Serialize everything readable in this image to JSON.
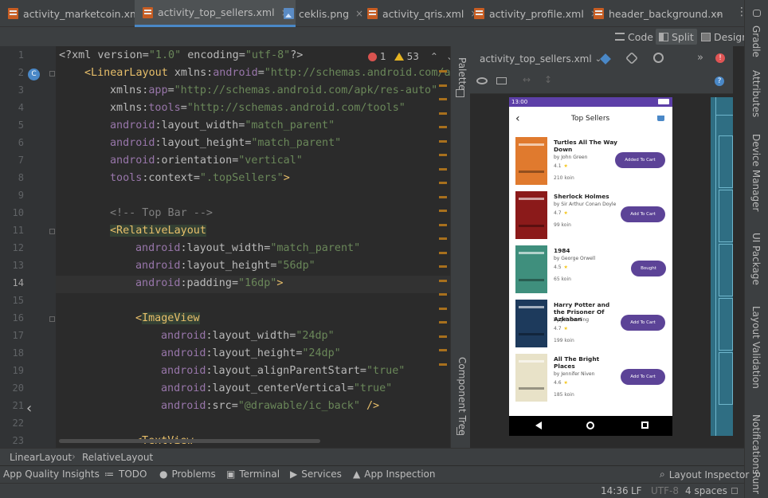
{
  "tabs": [
    {
      "label": "activity_marketcoin.xml",
      "type": "xml"
    },
    {
      "label": "activity_top_sellers.xml",
      "type": "xml",
      "active": true
    },
    {
      "label": "ceklis.png",
      "type": "png"
    },
    {
      "label": "activity_qris.xml",
      "type": "xml"
    },
    {
      "label": "activity_profile.xml",
      "type": "xml"
    },
    {
      "label": "header_background.xn",
      "type": "xml"
    }
  ],
  "view_modes": {
    "code": "Code",
    "split": "Split",
    "design": "Design",
    "selected": "Split"
  },
  "inspections": {
    "errors": "1",
    "warnings": "53"
  },
  "line_numbers": [
    "1",
    "2",
    "3",
    "4",
    "5",
    "6",
    "7",
    "8",
    "9",
    "10",
    "11",
    "12",
    "13",
    "14",
    "15",
    "16",
    "17",
    "18",
    "19",
    "20",
    "21",
    "22",
    "23"
  ],
  "code": {
    "l1": {
      "p1": "<?xml version=",
      "v1": "\"1.0\"",
      "p2": " encoding=",
      "v2": "\"utf-8\"",
      "p3": "?>"
    },
    "l2": {
      "tag": "<LinearLayout",
      "ns": " xmlns:",
      "attr": "android",
      "eq": "=",
      "val": "\"http://schemas.android.com/a"
    },
    "l3": {
      "ns": "xmlns:",
      "attr": "app",
      "eq": "=",
      "val": "\"http://schemas.android.com/apk/res-auto\""
    },
    "l4": {
      "ns": "xmlns:",
      "attr": "tools",
      "eq": "=",
      "val": "\"http://schemas.android.com/tools\""
    },
    "l5": {
      "ns": "android",
      "attr": ":layout_width",
      "eq": "=",
      "val": "\"match_parent\""
    },
    "l6": {
      "ns": "android",
      "attr": ":layout_height",
      "eq": "=",
      "val": "\"match_parent\""
    },
    "l7": {
      "ns": "android",
      "attr": ":orientation",
      "eq": "=",
      "val": "\"vertical\""
    },
    "l8": {
      "ns": "tools",
      "attr": ":context",
      "eq": "=",
      "val": "\".topSellers\"",
      "end": ">"
    },
    "l10": "<!-- Top Bar -->",
    "l11": "<RelativeLayout",
    "l12": {
      "ns": "android",
      "attr": ":layout_width",
      "eq": "=",
      "val": "\"match_parent\""
    },
    "l13": {
      "ns": "android",
      "attr": ":layout_height",
      "eq": "=",
      "val": "\"56dp\""
    },
    "l14": {
      "ns": "android",
      "attr": ":padding",
      "eq": "=",
      "val": "\"16dp\"",
      "end": ">"
    },
    "l16": {
      "lt": "<",
      "tag": "ImageView"
    },
    "l17": {
      "ns": "android",
      "attr": ":layout_width",
      "eq": "=",
      "val": "\"24dp\""
    },
    "l18": {
      "ns": "android",
      "attr": ":layout_height",
      "eq": "=",
      "val": "\"24dp\""
    },
    "l19": {
      "ns": "android",
      "attr": ":layout_alignParentStart",
      "eq": "=",
      "val": "\"true\""
    },
    "l20": {
      "ns": "android",
      "attr": ":layout_centerVertical",
      "eq": "=",
      "val": "\"true\""
    },
    "l21": {
      "ns": "android",
      "attr": ":src",
      "eq": "=",
      "val": "\"@drawable/ic_back\"",
      "end": " />"
    },
    "l23": "<TextView"
  },
  "design_file": "activity_top_sellers.xml",
  "phone": {
    "time": "13:00",
    "title": "Top Sellers",
    "books": [
      {
        "title": "Turtles All The Way Down",
        "author": "by John Green",
        "rating": "4.1",
        "price": "210 koin",
        "button": "Added To Cart",
        "cover": "#e07a2e"
      },
      {
        "title": "Sherlock Holmes",
        "author": "by Sir Arthur Conan Doyle",
        "rating": "4.7",
        "price": "99 koin",
        "button": "Add To Cart",
        "cover": "#8b1a1a"
      },
      {
        "title": "1984",
        "author": "by George Orwell",
        "rating": "4.5",
        "price": "65 koin",
        "button": "Bought",
        "cover": "#3f8f7d"
      },
      {
        "title": "Harry Potter and the Prisoner Of Azkaban",
        "author": "by J.K. Rowling",
        "rating": "4.7",
        "price": "199 koin",
        "button": "Add To Cart",
        "cover": "#1d3a5c"
      },
      {
        "title": "All The Bright Places",
        "author": "by Jennifer Niven",
        "rating": "4.6",
        "price": "185 koin",
        "button": "Add To Cart",
        "cover": "#e8e2c8"
      }
    ]
  },
  "side_labels": {
    "gradle": "Gradle",
    "attributes": "Attributes",
    "device_manager": "Device Manager",
    "ui_package": "UI Package",
    "layout_validation": "Layout Validation",
    "notifications": "Notifications",
    "run": "Runr",
    "palette": "Palette",
    "component_tree": "Component Tree"
  },
  "breadcrumb": [
    "LinearLayout",
    "RelativeLayout"
  ],
  "tool_windows": [
    "App Quality Insights",
    "TODO",
    "Problems",
    "Terminal",
    "Services",
    "App Inspection"
  ],
  "layout_inspector": "Layout Inspector",
  "status": {
    "position": "14:36",
    "line_sep": "LF",
    "encoding": "UTF-8",
    "indent": "4 spaces"
  },
  "colors": {
    "accent": "#4a88c7",
    "purple": "#5c4397",
    "status_purple": "#5d3fa8"
  }
}
